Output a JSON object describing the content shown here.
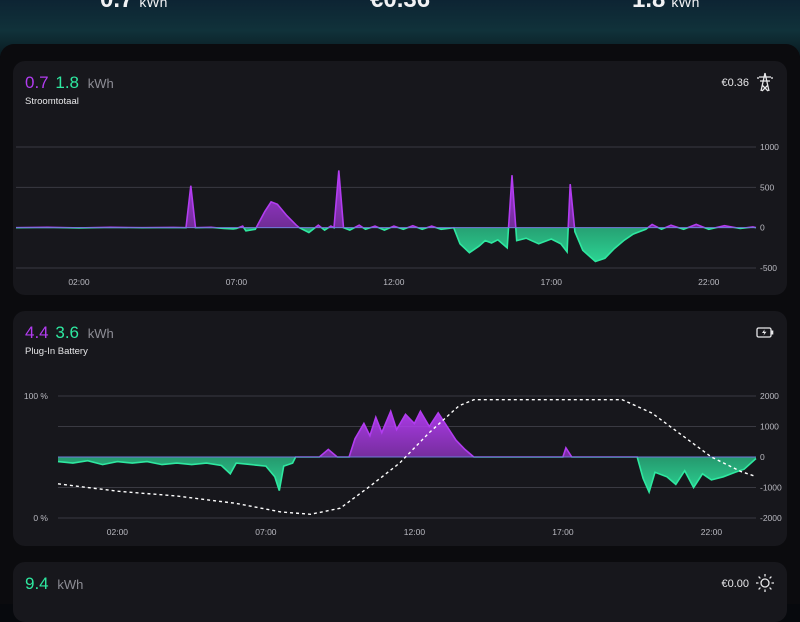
{
  "top_summary": {
    "import": {
      "value": "0.7",
      "unit": "kWh"
    },
    "cost": {
      "value": "€0.36"
    },
    "export": {
      "value": "1.8",
      "unit": "kWh"
    }
  },
  "cards": {
    "grid": {
      "import_value": "0.7",
      "export_value": "1.8",
      "unit": "kWh",
      "title": "Stroomtotaal",
      "price": "€0.36",
      "icon": "power-pylon-icon"
    },
    "battery": {
      "import_value": "4.4",
      "export_value": "3.6",
      "unit": "kWh",
      "title": "Plug-In Battery",
      "icon": "battery-charging-icon"
    },
    "solar": {
      "export_value": "9.4",
      "unit": "kWh",
      "price": "€0.00",
      "icon": "sun-icon"
    }
  },
  "colors": {
    "import": "#b23cf0",
    "export": "#2ee8a0",
    "soc_line": "#ffffff",
    "grid_line": "#3a3a42"
  },
  "chart_data": [
    {
      "type": "area",
      "name": "grid-power",
      "x_ticks": [
        "02:00",
        "07:00",
        "12:00",
        "17:00",
        "22:00"
      ],
      "x_tick_hours": [
        2,
        7,
        12,
        17,
        22
      ],
      "x_range": [
        0,
        23.5
      ],
      "y_ticks": [
        "1000",
        "500",
        "0",
        "-500"
      ],
      "y_tick_values": [
        1000,
        500,
        0,
        -500
      ],
      "ylim": [
        -500,
        1000
      ],
      "points": [
        [
          0,
          0
        ],
        [
          1,
          5
        ],
        [
          2,
          -3
        ],
        [
          3,
          4
        ],
        [
          4,
          0
        ],
        [
          5,
          3
        ],
        [
          5.4,
          0
        ],
        [
          5.55,
          520
        ],
        [
          5.7,
          0
        ],
        [
          6.2,
          5
        ],
        [
          6.6,
          -10
        ],
        [
          6.9,
          -15
        ],
        [
          7,
          -10
        ],
        [
          7.2,
          20
        ],
        [
          7.3,
          -40
        ],
        [
          7.6,
          -20
        ],
        [
          7.9,
          200
        ],
        [
          8.1,
          320
        ],
        [
          8.3,
          290
        ],
        [
          8.6,
          150
        ],
        [
          8.9,
          30
        ],
        [
          9,
          0
        ],
        [
          9.3,
          -60
        ],
        [
          9.6,
          30
        ],
        [
          9.8,
          -30
        ],
        [
          10,
          20
        ],
        [
          10.1,
          0
        ],
        [
          10.25,
          710
        ],
        [
          10.4,
          0
        ],
        [
          10.6,
          -30
        ],
        [
          10.9,
          30
        ],
        [
          11.1,
          -20
        ],
        [
          11.4,
          20
        ],
        [
          11.7,
          -30
        ],
        [
          12,
          20
        ],
        [
          12.3,
          -20
        ],
        [
          12.6,
          25
        ],
        [
          12.9,
          -20
        ],
        [
          13.2,
          20
        ],
        [
          13.5,
          -20
        ],
        [
          13.9,
          0
        ],
        [
          14.1,
          -200
        ],
        [
          14.4,
          -310
        ],
        [
          14.7,
          -230
        ],
        [
          14.9,
          -160
        ],
        [
          15.1,
          -190
        ],
        [
          15.3,
          -150
        ],
        [
          15.6,
          -250
        ],
        [
          15.75,
          650
        ],
        [
          15.9,
          -160
        ],
        [
          16.2,
          -130
        ],
        [
          16.6,
          -200
        ],
        [
          17,
          -140
        ],
        [
          17.3,
          -200
        ],
        [
          17.5,
          -300
        ],
        [
          17.6,
          540
        ],
        [
          17.75,
          -50
        ],
        [
          18,
          -280
        ],
        [
          18.2,
          -350
        ],
        [
          18.4,
          -420
        ],
        [
          18.7,
          -380
        ],
        [
          19,
          -260
        ],
        [
          19.3,
          -160
        ],
        [
          19.6,
          -80
        ],
        [
          20,
          -20
        ],
        [
          20.2,
          40
        ],
        [
          20.5,
          -20
        ],
        [
          20.8,
          30
        ],
        [
          21.2,
          -20
        ],
        [
          21.6,
          40
        ],
        [
          22,
          -20
        ],
        [
          22.5,
          25
        ],
        [
          23,
          -10
        ],
        [
          23.4,
          10
        ],
        [
          23.5,
          0
        ]
      ]
    },
    {
      "type": "area",
      "name": "battery-power",
      "x_ticks": [
        "02:00",
        "07:00",
        "12:00",
        "17:00",
        "22:00"
      ],
      "x_tick_hours": [
        2,
        7,
        12,
        17,
        22
      ],
      "x_range": [
        0,
        23.5
      ],
      "y_ticks": [
        "2000",
        "1000",
        "0",
        "-1000",
        "-2000"
      ],
      "y_tick_values": [
        2000,
        1000,
        0,
        -1000,
        -2000
      ],
      "ylim": [
        -2000,
        2000
      ],
      "soc_ticks": [
        "100 %",
        "0 %"
      ],
      "soc_tick_values": [
        100,
        0
      ],
      "points": [
        [
          0,
          -150
        ],
        [
          0.5,
          -200
        ],
        [
          1,
          -120
        ],
        [
          1.5,
          -250
        ],
        [
          2,
          -150
        ],
        [
          2.5,
          -200
        ],
        [
          3,
          -150
        ],
        [
          3.5,
          -250
        ],
        [
          4,
          -200
        ],
        [
          4.5,
          -250
        ],
        [
          5,
          -200
        ],
        [
          5.5,
          -280
        ],
        [
          5.8,
          -550
        ],
        [
          6,
          -200
        ],
        [
          6.5,
          -250
        ],
        [
          7,
          -300
        ],
        [
          7.3,
          -650
        ],
        [
          7.45,
          -1100
        ],
        [
          7.6,
          -300
        ],
        [
          7.9,
          -200
        ],
        [
          8,
          0
        ],
        [
          8.8,
          0
        ],
        [
          9.1,
          250
        ],
        [
          9.4,
          0
        ],
        [
          9.8,
          0
        ],
        [
          10,
          600
        ],
        [
          10.3,
          1100
        ],
        [
          10.5,
          700
        ],
        [
          10.7,
          1300
        ],
        [
          10.9,
          800
        ],
        [
          11.2,
          1500
        ],
        [
          11.4,
          900
        ],
        [
          11.7,
          1400
        ],
        [
          12,
          1100
        ],
        [
          12.2,
          1500
        ],
        [
          12.5,
          1000
        ],
        [
          12.8,
          1450
        ],
        [
          13.1,
          1000
        ],
        [
          13.4,
          550
        ],
        [
          13.7,
          250
        ],
        [
          14,
          0
        ],
        [
          17,
          0
        ],
        [
          17.1,
          300
        ],
        [
          17.3,
          0
        ],
        [
          19.5,
          0
        ],
        [
          19.7,
          -700
        ],
        [
          19.9,
          -1150
        ],
        [
          20.1,
          -500
        ],
        [
          20.5,
          -650
        ],
        [
          20.8,
          -900
        ],
        [
          21.1,
          -450
        ],
        [
          21.4,
          -1000
        ],
        [
          21.7,
          -550
        ],
        [
          22,
          -750
        ],
        [
          22.4,
          -650
        ],
        [
          22.8,
          -500
        ],
        [
          23.1,
          -400
        ],
        [
          23.5,
          -50
        ]
      ],
      "soc_points": [
        [
          0,
          28
        ],
        [
          2,
          22
        ],
        [
          4,
          18
        ],
        [
          6,
          12
        ],
        [
          7.5,
          5
        ],
        [
          8.5,
          3
        ],
        [
          9.5,
          8
        ],
        [
          10.5,
          26
        ],
        [
          11.5,
          45
        ],
        [
          12.5,
          70
        ],
        [
          13.5,
          92
        ],
        [
          14,
          97
        ],
        [
          15,
          97
        ],
        [
          17,
          97
        ],
        [
          19,
          97
        ],
        [
          20,
          86
        ],
        [
          21,
          68
        ],
        [
          22,
          50
        ],
        [
          23,
          38
        ],
        [
          23.5,
          34
        ]
      ]
    }
  ]
}
